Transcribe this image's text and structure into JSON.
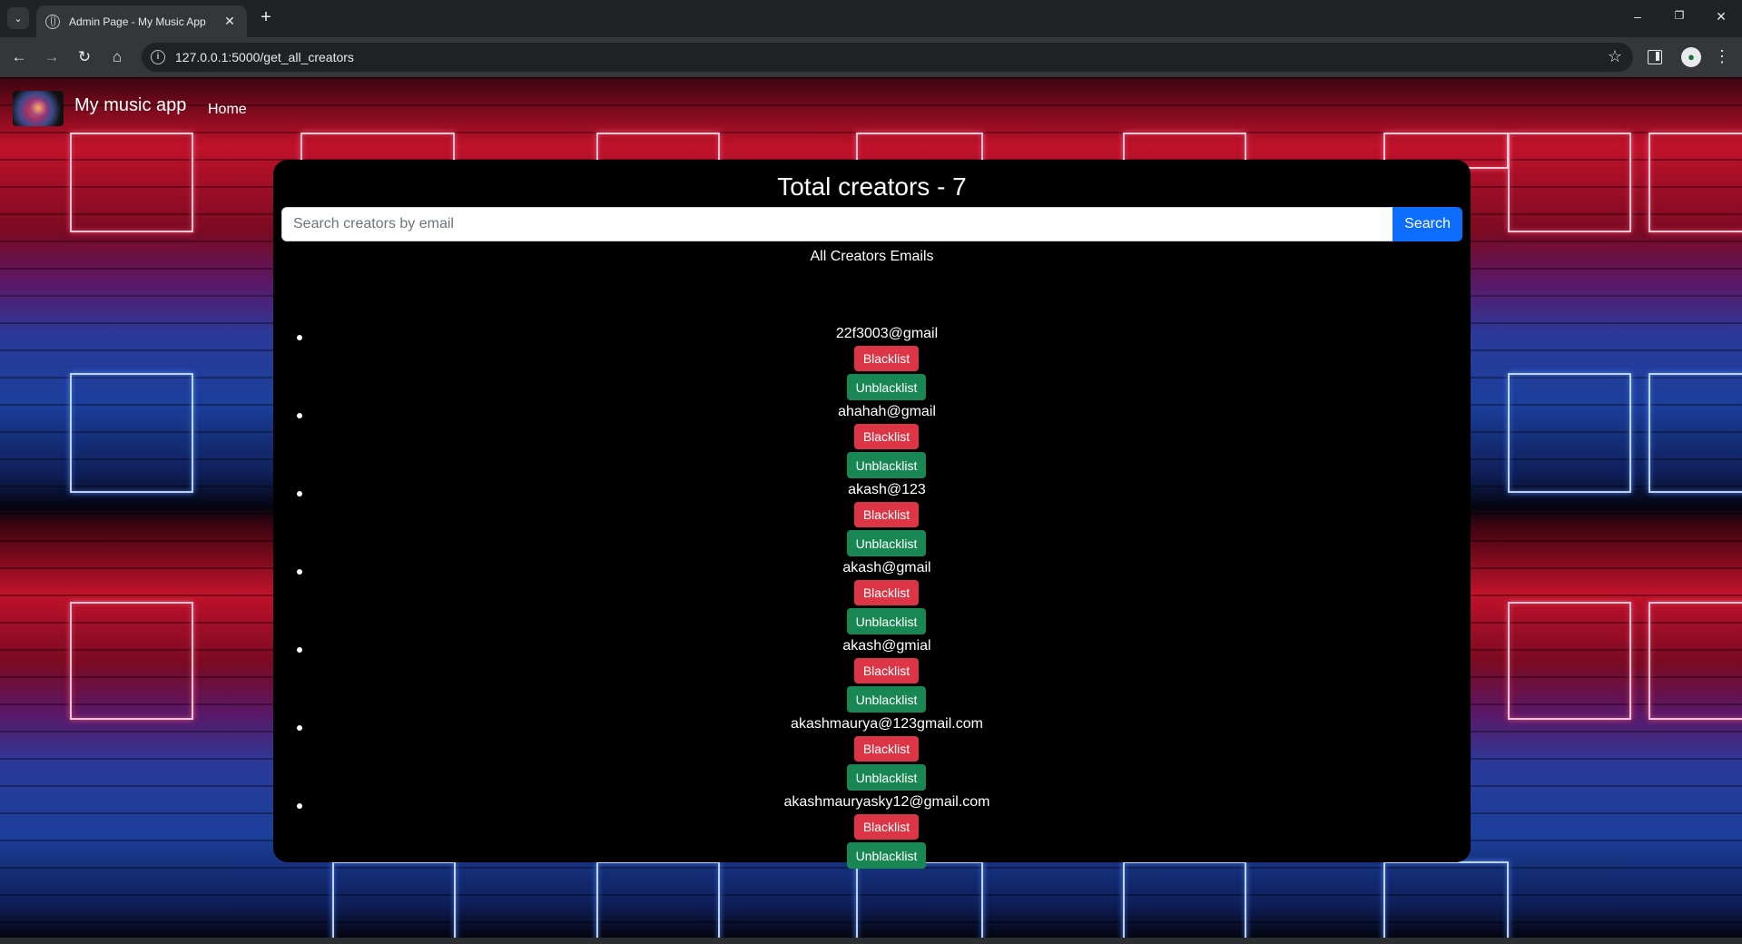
{
  "browser": {
    "tab_title": "Admin Page - My Music App",
    "url": "127.0.0.1:5000/get_all_creators",
    "icons": {
      "tab_list": "chevron-down-icon",
      "tab_close": "close-icon",
      "new_tab": "plus-icon",
      "back": "arrow-left-icon",
      "forward": "arrow-right-icon",
      "reload": "reload-icon",
      "home": "home-icon",
      "site_info": "info-icon",
      "bookmark": "star-icon",
      "side_panel": "side-panel-icon",
      "menu": "kebab-menu-icon"
    }
  },
  "navbar": {
    "brand": "My music app",
    "home_link": "Home"
  },
  "main": {
    "title": "Total creators - 7",
    "search": {
      "placeholder": "Search creators by email",
      "value": "",
      "button_label": "Search"
    },
    "list_heading": "All Creators Emails",
    "creators": [
      {
        "email": "22f3003@gmail",
        "blacklist_label": "Blacklist",
        "unblacklist_label": "Unblacklist"
      },
      {
        "email": "ahahah@gmail",
        "blacklist_label": "Blacklist",
        "unblacklist_label": "Unblacklist"
      },
      {
        "email": "akash@123",
        "blacklist_label": "Blacklist",
        "unblacklist_label": "Unblacklist"
      },
      {
        "email": "akash@gmail",
        "blacklist_label": "Blacklist",
        "unblacklist_label": "Unblacklist"
      },
      {
        "email": "akash@gmial",
        "blacklist_label": "Blacklist",
        "unblacklist_label": "Unblacklist"
      },
      {
        "email": "akashmaurya@123gmail.com",
        "blacklist_label": "Blacklist",
        "unblacklist_label": "Unblacklist"
      },
      {
        "email": "akashmauryasky12@gmail.com",
        "blacklist_label": "Blacklist",
        "unblacklist_label": "Unblacklist"
      }
    ]
  },
  "colors": {
    "search_button": "#0d6efd",
    "blacklist_button": "#dc3545",
    "unblacklist_button": "#198754",
    "card_background": "#000000"
  }
}
